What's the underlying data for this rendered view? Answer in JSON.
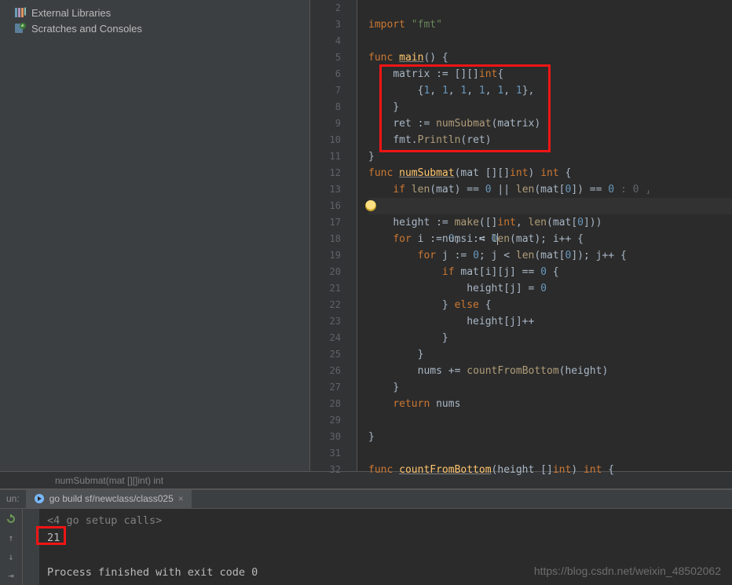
{
  "project": {
    "external_libs": "External Libraries",
    "scratches": "Scratches and Consoles"
  },
  "line_numbers": [
    "2",
    "3",
    "4",
    "5",
    "6",
    "7",
    "8",
    "9",
    "10",
    "11",
    "12",
    "13",
    "16",
    "17",
    "18",
    "19",
    "20",
    "21",
    "22",
    "23",
    "24",
    "25",
    "26",
    "27",
    "28",
    "29",
    "30",
    "31",
    "32"
  ],
  "code": {
    "l2": "",
    "l3_import": "import",
    "l3_fmt": "\"fmt\"",
    "l5_func": "func",
    "l5_main": "main",
    "l5_rest": "() {",
    "l6_a": "matrix := [][]",
    "l6_int": "int",
    "l6_b": "{",
    "l7_a": "{",
    "l7_n1": "1",
    "l7_n2": "1",
    "l7_n3": "1",
    "l7_n4": "1",
    "l7_n5": "1",
    "l7_n6": "1",
    "l7_b": "},",
    "l8": "}",
    "l9_a": "ret := ",
    "l9_fn": "numSubmat",
    "l9_b": "(matrix)",
    "l10_a": "fmt.",
    "l10_fn": "Println",
    "l10_b": "(ret)",
    "l11": "}",
    "l12_func": "func",
    "l12_name": "numSubmat",
    "l12_sig1": "(mat [][]",
    "l12_int": "int",
    "l12_sig2": ") ",
    "l12_ret": "int",
    "l12_brace": " {",
    "l13_if": "if",
    "l13_a": " ",
    "l13_len1": "len",
    "l13_b": "(mat) == ",
    "l13_z1": "0",
    "l13_or": " || ",
    "l13_len2": "len",
    "l13_c": "(mat[",
    "l13_z2": "0",
    "l13_d": "]) == ",
    "l13_z3": "0",
    "l13_hint": " : 0 ⸥",
    "l16_a": "nums := ",
    "l16_z": "0",
    "l17_a": "height := ",
    "l17_make": "make",
    "l17_b": "([]",
    "l17_int": "int",
    "l17_c": ", ",
    "l17_len": "len",
    "l17_d": "(mat[",
    "l17_z": "0",
    "l17_e": "]))",
    "l18_for": "for",
    "l18_a": " i := ",
    "l18_z": "0",
    "l18_b": "; i < ",
    "l18_len": "len",
    "l18_c": "(mat); i++ {",
    "l19_for": "for",
    "l19_a": " j := ",
    "l19_z": "0",
    "l19_b": "; j < ",
    "l19_len": "len",
    "l19_c": "(mat[",
    "l19_z2": "0",
    "l19_d": "]); j++ {",
    "l20_if": "if",
    "l20_a": " mat[i][j] == ",
    "l20_z": "0",
    "l20_b": " {",
    "l21_a": "height[j] = ",
    "l21_z": "0",
    "l22_a": "} ",
    "l22_else": "else",
    "l22_b": " {",
    "l23": "height[j]++",
    "l24": "}",
    "l25": "}",
    "l26_a": "nums += ",
    "l26_fn": "countFromBottom",
    "l26_b": "(height)",
    "l27": "}",
    "l28_ret": "return",
    "l28_a": " nums",
    "l30": "}",
    "l32_func": "func",
    "l32_name": "countFromBottom",
    "l32_sig1": "(height []",
    "l32_int": "int",
    "l32_sig2": ") ",
    "l32_ret": "int",
    "l32_brace": " {"
  },
  "breadcrumb": "numSubmat(mat [][]int) int",
  "run": {
    "tool_label": "un:",
    "tab_label": "go build sf/newclass/class025",
    "setup": "<4 go setup calls>",
    "output": "21",
    "exit": "Process finished with exit code 0"
  },
  "watermark": "https://blog.csdn.net/weixin_48502062"
}
